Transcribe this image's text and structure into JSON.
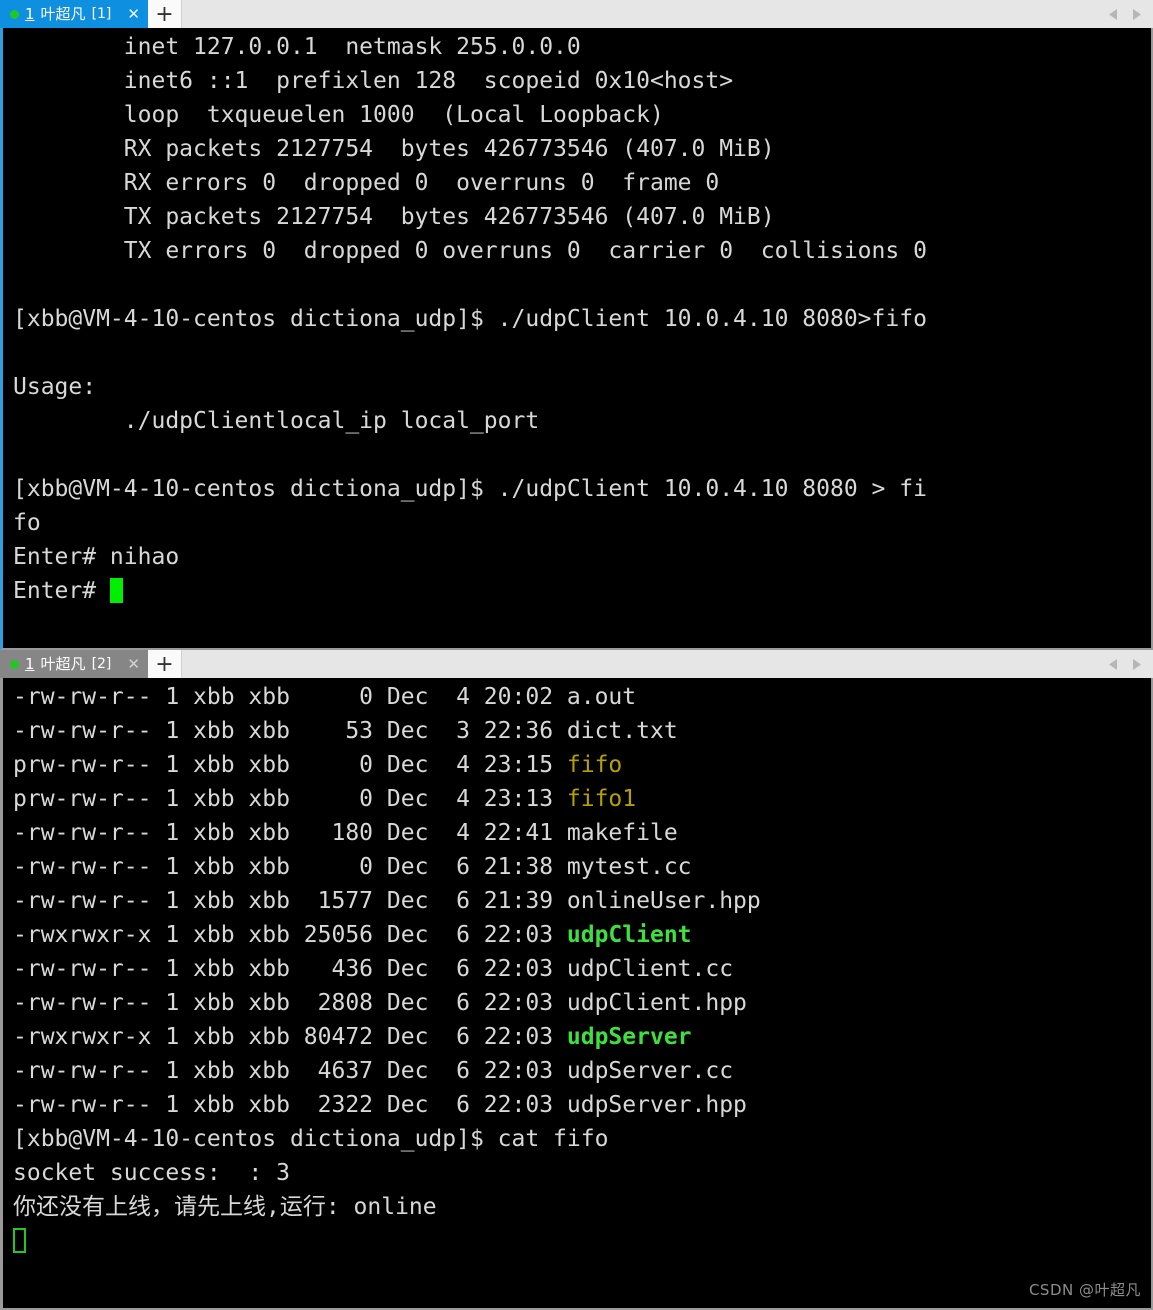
{
  "window": {
    "accent_blue": "#0f8fe0",
    "inactive_gray": "#868686",
    "terminal_bg": "#000000",
    "terminal_fg": "#d8d8d8",
    "exec_green": "#3fdf3f",
    "fifo_yellow": "#b5a000",
    "cursor_green": "#00ee00"
  },
  "panes": [
    {
      "tab": {
        "number": "1",
        "title": "叶超凡",
        "index": "[1]",
        "close_label": "✕",
        "newtab_label": "+",
        "status": "connected"
      },
      "lines": [
        [
          {
            "t": "        inet 127.0.0.1  netmask 255.0.0.0",
            "c": "white"
          }
        ],
        [
          {
            "t": "        inet6 ::1  prefixlen 128  scopeid 0x10<host>",
            "c": "white"
          }
        ],
        [
          {
            "t": "        loop  txqueuelen 1000  (Local Loopback)",
            "c": "white"
          }
        ],
        [
          {
            "t": "        RX packets 2127754  bytes 426773546 (407.0 MiB)",
            "c": "white"
          }
        ],
        [
          {
            "t": "        RX errors 0  dropped 0  overruns 0  frame 0",
            "c": "white"
          }
        ],
        [
          {
            "t": "        TX packets 2127754  bytes 426773546 (407.0 MiB)",
            "c": "white"
          }
        ],
        [
          {
            "t": "        TX errors 0  dropped 0 overruns 0  carrier 0  collisions 0",
            "c": "white"
          }
        ],
        [
          {
            "t": "",
            "c": "white"
          }
        ],
        [
          {
            "t": "[xbb@VM-4-10-centos dictiona_udp]$ ./udpClient 10.0.4.10 8080>fifo",
            "c": "white"
          }
        ],
        [
          {
            "t": "",
            "c": "white"
          }
        ],
        [
          {
            "t": "Usage:",
            "c": "white"
          }
        ],
        [
          {
            "t": "        ./udpClientlocal_ip local_port",
            "c": "white"
          }
        ],
        [
          {
            "t": "",
            "c": "white"
          }
        ],
        [
          {
            "t": "[xbb@VM-4-10-centos dictiona_udp]$ ./udpClient 10.0.4.10 8080 > fi",
            "c": "white"
          }
        ],
        [
          {
            "t": "fo",
            "c": "white"
          }
        ],
        [
          {
            "t": "Enter# nihao",
            "c": "white"
          }
        ],
        [
          {
            "t": "Enter# ",
            "c": "white"
          },
          {
            "t": "",
            "c": "cursor-filled"
          }
        ]
      ]
    },
    {
      "tab": {
        "number": "1",
        "title": "叶超凡",
        "index": "[2]",
        "close_label": "✕",
        "newtab_label": "+",
        "status": "connected"
      },
      "lines": [
        [
          {
            "t": "-rw-rw-r-- 1 xbb xbb     0 Dec  4 20:02 a.out",
            "c": "white"
          }
        ],
        [
          {
            "t": "-rw-rw-r-- 1 xbb xbb    53 Dec  3 22:36 dict.txt",
            "c": "white"
          }
        ],
        [
          {
            "t": "prw-rw-r-- 1 xbb xbb     0 Dec  4 23:15 ",
            "c": "white"
          },
          {
            "t": "fifo",
            "c": "yellow"
          }
        ],
        [
          {
            "t": "prw-rw-r-- 1 xbb xbb     0 Dec  4 23:13 ",
            "c": "white"
          },
          {
            "t": "fifo1",
            "c": "yellow"
          }
        ],
        [
          {
            "t": "-rw-rw-r-- 1 xbb xbb   180 Dec  4 22:41 makefile",
            "c": "white"
          }
        ],
        [
          {
            "t": "-rw-rw-r-- 1 xbb xbb     0 Dec  6 21:38 mytest.cc",
            "c": "white"
          }
        ],
        [
          {
            "t": "-rw-rw-r-- 1 xbb xbb  1577 Dec  6 21:39 onlineUser.hpp",
            "c": "white"
          }
        ],
        [
          {
            "t": "-rwxrwxr-x 1 xbb xbb 25056 Dec  6 22:03 ",
            "c": "white"
          },
          {
            "t": "udpClient",
            "c": "green"
          }
        ],
        [
          {
            "t": "-rw-rw-r-- 1 xbb xbb   436 Dec  6 22:03 udpClient.cc",
            "c": "white"
          }
        ],
        [
          {
            "t": "-rw-rw-r-- 1 xbb xbb  2808 Dec  6 22:03 udpClient.hpp",
            "c": "white"
          }
        ],
        [
          {
            "t": "-rwxrwxr-x 1 xbb xbb 80472 Dec  6 22:03 ",
            "c": "white"
          },
          {
            "t": "udpServer",
            "c": "green"
          }
        ],
        [
          {
            "t": "-rw-rw-r-- 1 xbb xbb  4637 Dec  6 22:03 udpServer.cc",
            "c": "white"
          }
        ],
        [
          {
            "t": "-rw-rw-r-- 1 xbb xbb  2322 Dec  6 22:03 udpServer.hpp",
            "c": "white"
          }
        ],
        [
          {
            "t": "[xbb@VM-4-10-centos dictiona_udp]$ cat fifo",
            "c": "white"
          }
        ],
        [
          {
            "t": "socket success:  : 3",
            "c": "white"
          }
        ],
        [
          {
            "t": "你还没有上线，请先上线,运行: online",
            "c": "white"
          }
        ],
        [
          {
            "t": "",
            "c": "cursor-hollow"
          }
        ]
      ]
    }
  ],
  "watermark": "CSDN @叶超凡"
}
